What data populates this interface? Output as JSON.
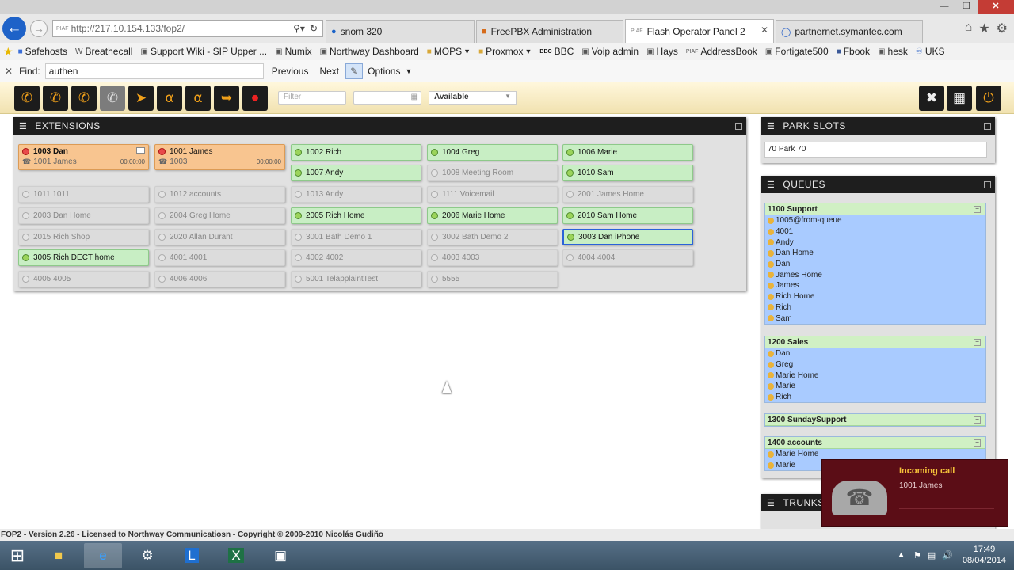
{
  "browser": {
    "address_url": "http://217.10.154.133/fop2/",
    "address_badge": "PIAF",
    "tabs": [
      {
        "label": "snom 320",
        "active": false
      },
      {
        "label": "FreePBX Administration",
        "active": false
      },
      {
        "label": "Flash Operator Panel 2",
        "badge": "PIAF",
        "active": true
      },
      {
        "label": "partnernet.symantec.com",
        "active": false
      }
    ],
    "favorites": [
      "Safehosts",
      "Breathecall",
      "Support Wiki - SIP Upper ...",
      "Numix",
      "Northway Dashboard",
      "MOPS",
      "Proxmox",
      "BBC",
      "Voip admin",
      "Hays",
      "AddressBook",
      "Fortigate500",
      "Fbook",
      "hesk",
      "UKS"
    ],
    "favorites_badges": {
      "bbc": "BBC",
      "addressbook": "PIAF"
    },
    "find": {
      "label": "Find:",
      "value": "authen",
      "previous": "Previous",
      "next": "Next",
      "options": "Options"
    }
  },
  "toolbar": {
    "filter_placeholder": "Filter",
    "status_value": "Available"
  },
  "extensions_panel": {
    "title": "EXTENSIONS",
    "items": [
      {
        "label": "1003 Dan",
        "state": "busy",
        "caller": "1001 James",
        "timer": "00:00:00",
        "mail": true
      },
      {
        "label": "1001 James",
        "state": "busy",
        "caller": "1003",
        "timer": "00:00:00"
      },
      {
        "label": "1002 Rich",
        "state": "on"
      },
      {
        "label": "1004 Greg",
        "state": "on"
      },
      {
        "label": "1006 Marie",
        "state": "on"
      },
      {
        "label": "1007 Andy",
        "state": "on"
      },
      {
        "label": "1008 Meeting Room",
        "state": "off"
      },
      {
        "label": "1010 Sam",
        "state": "on"
      },
      {
        "label": "1011 1011",
        "state": "off"
      },
      {
        "label": "1012 accounts",
        "state": "off"
      },
      {
        "label": "1013 Andy",
        "state": "off"
      },
      {
        "label": "1111 Voicemail",
        "state": "off"
      },
      {
        "label": "2001 James Home",
        "state": "off"
      },
      {
        "label": "2003 Dan Home",
        "state": "off"
      },
      {
        "label": "2004 Greg Home",
        "state": "off"
      },
      {
        "label": "2005 Rich Home",
        "state": "on"
      },
      {
        "label": "2006 Marie Home",
        "state": "on"
      },
      {
        "label": "2010 Sam Home",
        "state": "on"
      },
      {
        "label": "2015 Rich Shop",
        "state": "off"
      },
      {
        "label": "2020 Allan Durant",
        "state": "off"
      },
      {
        "label": "3001 Bath Demo 1",
        "state": "off"
      },
      {
        "label": "3002 Bath Demo 2",
        "state": "off"
      },
      {
        "label": "3003 Dan iPhone",
        "state": "on",
        "selected": true
      },
      {
        "label": "3005 Rich DECT home",
        "state": "on"
      },
      {
        "label": "4001 4001",
        "state": "off"
      },
      {
        "label": "4002 4002",
        "state": "off"
      },
      {
        "label": "4003 4003",
        "state": "off"
      },
      {
        "label": "4004 4004",
        "state": "off"
      },
      {
        "label": "4005 4005",
        "state": "off"
      },
      {
        "label": "4006 4006",
        "state": "off"
      },
      {
        "label": "5001 TelapplaintTest",
        "state": "off"
      },
      {
        "label": "5555",
        "state": "off"
      }
    ]
  },
  "park_panel": {
    "title": "PARK SLOTS",
    "slot": "70 Park 70"
  },
  "queues_panel": {
    "title": "QUEUES",
    "queues": [
      {
        "name": "1100 Support",
        "members": [
          "1005@from-queue",
          "4001",
          "Andy",
          "Dan Home",
          "Dan",
          "James Home",
          "James",
          "Rich Home",
          "Rich",
          "Sam"
        ]
      },
      {
        "name": "1200 Sales",
        "members": [
          "Dan",
          "Greg",
          "Marie Home",
          "Marie",
          "Rich"
        ]
      },
      {
        "name": "1300 SundaySupport",
        "members": []
      },
      {
        "name": "1400 accounts",
        "members": [
          "Marie Home",
          "Marie"
        ]
      }
    ]
  },
  "trunks_panel": {
    "title": "TRUNKS"
  },
  "popup": {
    "title": "Incoming call",
    "caller": "1001 James"
  },
  "status_bar": "FOP2 - Version 2.26 - Licensed to Northway Communicatiosn - Copyright © 2009-2010 Nicolás Gudiño",
  "taskbar": {
    "time": "17:49",
    "date": "08/04/2014"
  },
  "colors": {
    "toolbar_icon": "#f0a01a",
    "online": "#c8eec4",
    "busy": "#f8c590",
    "queue_members": "#a9cbff",
    "popup": "#5b0d16"
  }
}
